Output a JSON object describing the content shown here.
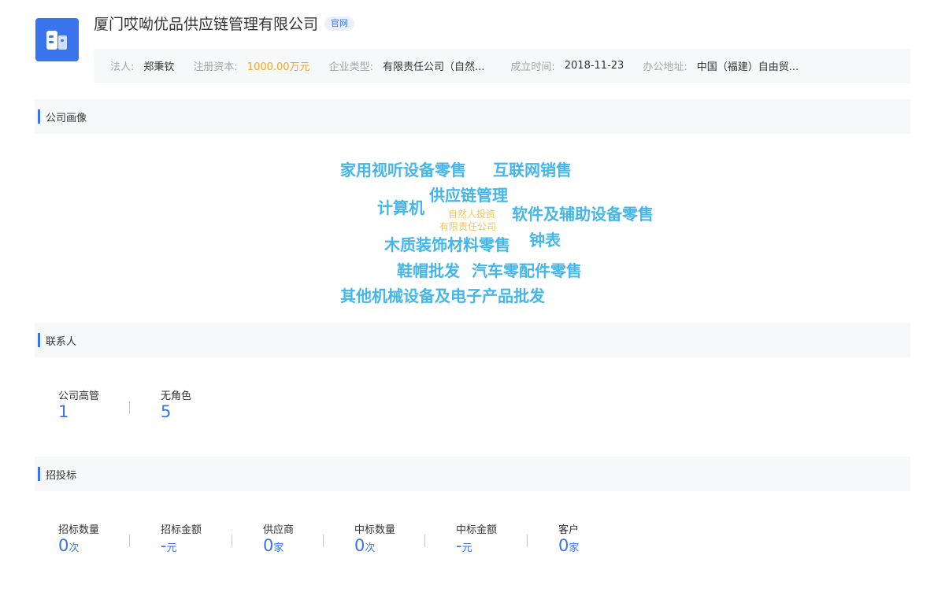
{
  "company": {
    "name": "厦门哎呦优品供应链管理有限公司",
    "official_tag": "官网",
    "logo_icon": "building-icon",
    "accent_color": "#3a73ee"
  },
  "info": [
    {
      "label": "法人:",
      "value": "郑秉钦"
    },
    {
      "label": "注册资本:",
      "value": "1000.00万元"
    },
    {
      "label": "企业类型:",
      "value": "有限责任公司（自然..."
    },
    {
      "label": "成立时间:",
      "value": "2018-11-23"
    },
    {
      "label": "办公地址:",
      "value": "中国（福建）自由贸..."
    }
  ],
  "sections": {
    "portrait": "公司画像",
    "contacts": "联系人",
    "bidding": "招投标"
  },
  "word_cloud": [
    "家用视听设备零售",
    "互联网销售",
    "供应链管理",
    "计算机",
    "自然人投资",
    "软件及辅助设备零售",
    "有限责任公司",
    "木质装饰材料零售",
    "钟表",
    "鞋帽批发",
    "汽车零配件零售",
    "其他机械设备及电子产品批发"
  ],
  "contacts": [
    {
      "label": "公司高管",
      "value": "1"
    },
    {
      "label": "无角色",
      "value": "5"
    }
  ],
  "bidding": [
    {
      "label": "招标数量",
      "value": "0",
      "unit": "次"
    },
    {
      "label": "招标金额",
      "value": "-",
      "unit": "元"
    },
    {
      "label": "供应商",
      "value": "0",
      "unit": "家"
    },
    {
      "label": "中标数量",
      "value": "0",
      "unit": "次"
    },
    {
      "label": "中标金额",
      "value": "-",
      "unit": "元"
    },
    {
      "label": "客户",
      "value": "0",
      "unit": "家"
    }
  ]
}
